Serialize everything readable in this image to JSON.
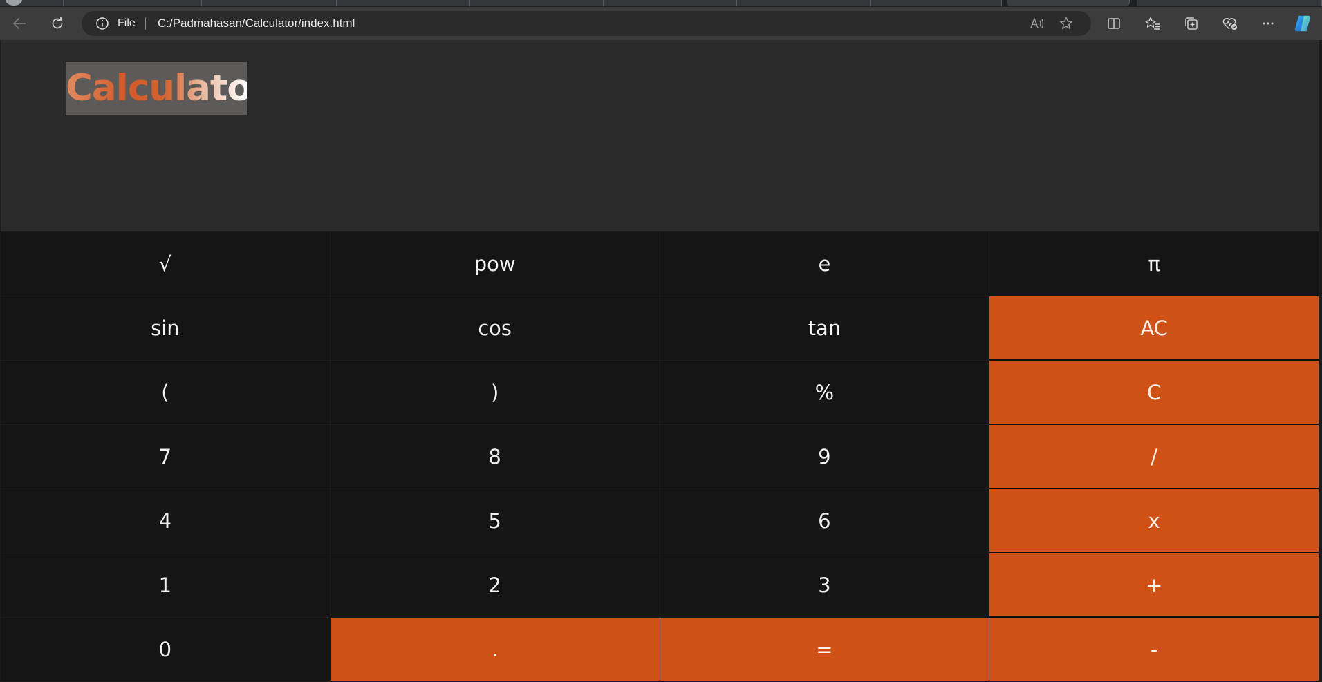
{
  "browser": {
    "address_prefix": "File",
    "address_url": "C:/Padmahasan/Calculator/index.html",
    "icons": {
      "back": "back-arrow-icon",
      "reload": "reload-icon",
      "site_info": "info-icon",
      "read_aloud": "read-aloud-icon",
      "favorite": "star-icon",
      "split_screen": "split-screen-icon",
      "favorites": "favorites-icon",
      "collections": "collections-icon",
      "browser_essentials": "heart-pulse-icon",
      "more": "more-icon",
      "copilot": "copilot-icon"
    }
  },
  "app": {
    "title": "Calculator",
    "display_value": "",
    "keys": [
      [
        "√",
        "pow",
        "e",
        "π"
      ],
      [
        "sin",
        "cos",
        "tan",
        "AC"
      ],
      [
        "(",
        ")",
        "%",
        "C"
      ],
      [
        "7",
        "8",
        "9",
        "/"
      ],
      [
        "4",
        "5",
        "6",
        "x"
      ],
      [
        "1",
        "2",
        "3",
        "+"
      ],
      [
        "0",
        ".",
        "=",
        "-"
      ]
    ]
  },
  "colors": {
    "accent": "#d05116",
    "key_background": "#151515",
    "display_background": "#2a2a2a",
    "key_text": "#f2f2f2"
  }
}
